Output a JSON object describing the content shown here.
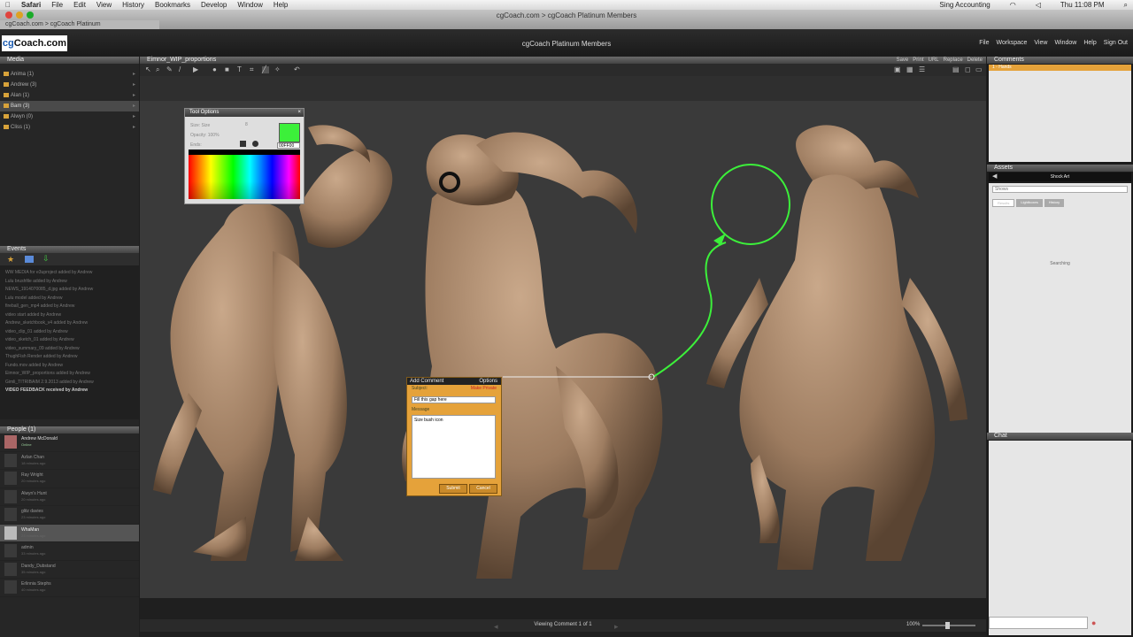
{
  "mac_menu": {
    "apple": "",
    "items": [
      "Safari",
      "File",
      "Edit",
      "View",
      "History",
      "Bookmarks",
      "Develop",
      "Window",
      "Help"
    ],
    "right_status": "Sing Accounting",
    "clock": "Thu 11:08 PM"
  },
  "safari": {
    "title": "cgCoach.com > cgCoach Platinum Members",
    "tab": "cgCoach.com > cgCoach Platinum"
  },
  "app": {
    "logo_a": "cg",
    "logo_b": "Coach.com",
    "title": "cgCoach Platinum Members",
    "menu": [
      "File",
      "Workspace",
      "View",
      "Window",
      "Help",
      "Sign Out"
    ]
  },
  "left": {
    "media_header": "Media",
    "folders": [
      {
        "label": "Anima (1)"
      },
      {
        "label": "Andrew (3)"
      },
      {
        "label": "Alan (1)"
      },
      {
        "label": "Bam (3)"
      },
      {
        "label": "Alwyn (0)"
      },
      {
        "label": "Cliss (1)"
      }
    ],
    "events_header": "Events",
    "events": [
      "WW MEDIA for e3uproject added by Andrew",
      "Lulu brushfile added by Andrew",
      "NEWS_1914070085_d.jpg added by Andrew",
      "Lulu model added by Andrew",
      "fireball_gen_mp4 added by Andrew",
      "video start added by Andrew",
      "Andrew_sketchbook_v4 added by Andrew",
      "video_clip_01 added by Andrew",
      "video_sketch_01 added by Andrew",
      "video_summary_09 added by Andrew",
      "ThughFish Render added by Andrew",
      "Fundo.mov added by Andrew",
      "Eimnor_WIP_proportions added by Andrew",
      "Gimli_TITRIBAIM  2.9.2013 added by Andrew"
    ],
    "events_highlight": "VIDEO FEEDBACK received by Andrew",
    "people_header": "People (1)",
    "people": [
      {
        "name": "Andrew McDonald",
        "status": "Online"
      },
      {
        "name": "Azlan Chan",
        "status": "18 minutes ago"
      },
      {
        "name": "Ray Wright",
        "status": "20 minutes ago"
      },
      {
        "name": "Alwyn's Hunt",
        "status": "20 minutes ago"
      },
      {
        "name": "glitz davies",
        "status": "23 minutes ago"
      },
      {
        "name": "WhaMan",
        "status": "23 minutes ago"
      },
      {
        "name": "admin",
        "status": "33 minutes ago"
      },
      {
        "name": "Dandy_Dubstand",
        "status": "35 minutes ago"
      },
      {
        "name": "Erlinnia Stephs",
        "status": "40 minutes ago"
      }
    ]
  },
  "center": {
    "tab": "Eimnor_WIP_proportions",
    "top_links": [
      "Save",
      "Print",
      "URL",
      "Replace",
      "Delete"
    ],
    "tool_options": {
      "title": "Tool Options",
      "size_label": "Size: Size",
      "opacity_label": "Opacity: 100%",
      "ends_label": "Ends:",
      "hex": "00FF00",
      "size_val": "8"
    },
    "add_comment": {
      "title": "Add Comment",
      "options": "Options",
      "subject_label": "Subject:",
      "private_label": "Make Private",
      "subject_value": "Fill this gap here",
      "message_label": "Message",
      "message_value": "Size bush icon",
      "submit": "Submit",
      "cancel": "Cancel"
    },
    "bottom": {
      "viewing": "Viewing Comment 1 of 1",
      "zoom": "100%"
    }
  },
  "right": {
    "comments_header": "Comments",
    "comment_item": "1 - Hands",
    "assets_header": "Assets",
    "assets_title": "Shock Art",
    "search_placeholder": "Shows",
    "tabs": [
      "Results",
      "Lightboxes",
      "History"
    ],
    "searching": "Searching",
    "chat_header": "Chat"
  },
  "colors": {
    "accent_orange": "#e5a23a",
    "annotation_green": "#3cf03a",
    "background": "#3a3a3a"
  }
}
